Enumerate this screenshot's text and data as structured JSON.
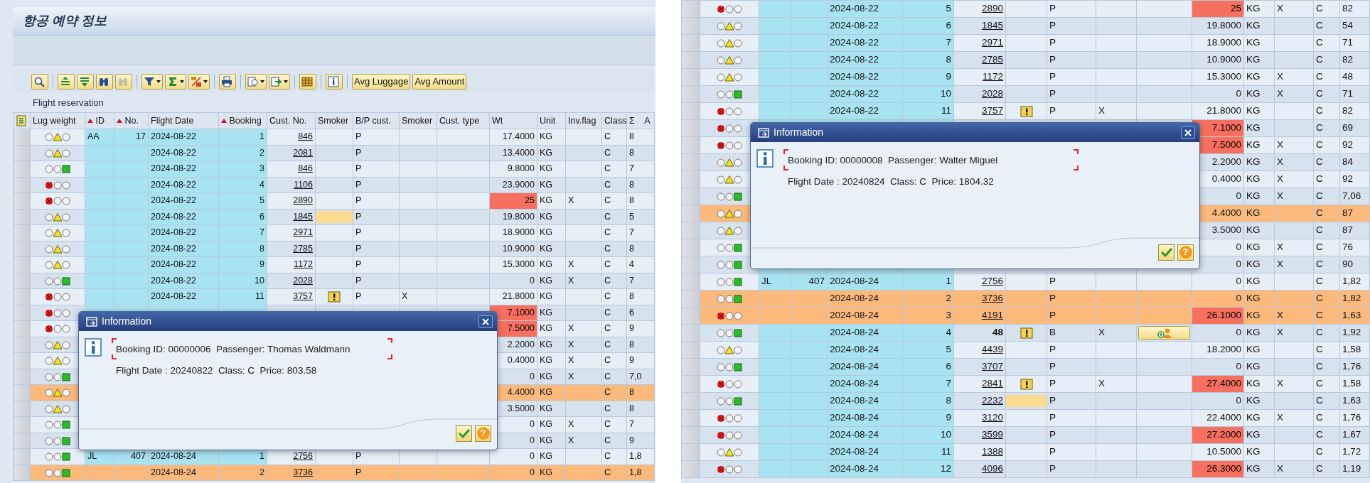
{
  "left_window": {
    "title": "항공 예약 정보",
    "toolbar": [
      {
        "kind": "icon",
        "dropdown": false,
        "disabled": false
      },
      {
        "kind": "icon",
        "dropdown": false,
        "disabled": false
      },
      {
        "kind": "icon",
        "dropdown": false,
        "disabled": false
      },
      {
        "kind": "icon",
        "dropdown": false,
        "disabled": false
      },
      {
        "kind": "icon",
        "dropdown": false,
        "disabled": true
      },
      {
        "kind": "icon",
        "dropdown": true,
        "disabled": false
      },
      {
        "kind": "icon",
        "dropdown": true,
        "disabled": false
      },
      {
        "kind": "icon",
        "dropdown": true,
        "disabled": false
      },
      {
        "kind": "icon",
        "dropdown": false,
        "disabled": false
      },
      {
        "kind": "icon",
        "dropdown": true,
        "disabled": false
      },
      {
        "kind": "icon",
        "dropdown": true,
        "disabled": false
      },
      {
        "kind": "icon",
        "dropdown": false,
        "disabled": false
      },
      {
        "kind": "icon",
        "dropdown": false,
        "disabled": false
      },
      {
        "kind": "text",
        "label": "Avg Luggage"
      },
      {
        "kind": "text",
        "label": "Avg Amount"
      }
    ],
    "grid_title": "Flight reservation",
    "columns": [
      {
        "label": "Lug weight",
        "sorted": false
      },
      {
        "label": "ID",
        "sorted": true
      },
      {
        "label": "No.",
        "sorted": true
      },
      {
        "label": "Flight Date",
        "sorted": false
      },
      {
        "label": "Booking",
        "sorted": true
      },
      {
        "label": "Cust. No.",
        "sorted": false
      },
      {
        "label": "Smoker",
        "sorted": false
      },
      {
        "label": "B/P cust.",
        "sorted": false
      },
      {
        "label": "Smoker",
        "sorted": false
      },
      {
        "label": "Cust. type",
        "sorted": false
      },
      {
        "label": "Wt",
        "sorted": false
      },
      {
        "label": "Unit",
        "sorted": false
      },
      {
        "label": "Inv.flag",
        "sorted": false
      },
      {
        "label": "Class",
        "sorted": false
      },
      {
        "label": "A",
        "sum_sign": "Σ",
        "sorted": false
      }
    ],
    "rows": [
      {
        "light": {
          "kind": "yellow"
        },
        "id": "AA",
        "no": "17",
        "date": "2024-08-22",
        "booking": "1",
        "cust": "846",
        "cust_link": true,
        "bp": "P",
        "wt": "17.4000",
        "wt_alert": false,
        "unit": "KG",
        "cls": "C",
        "amount": "8",
        "highlight": false
      },
      {
        "light": {
          "kind": "yellow"
        },
        "date": "2024-08-22",
        "booking": "2",
        "cust": "2081",
        "cust_link": true,
        "bp": "P",
        "wt": "13.4000",
        "wt_alert": false,
        "unit": "KG",
        "cls": "C",
        "amount": "8",
        "highlight": false
      },
      {
        "light": {
          "kind": "green"
        },
        "date": "2024-08-22",
        "booking": "3",
        "cust": "846",
        "cust_link": true,
        "bp": "P",
        "wt": "9.8000",
        "wt_alert": false,
        "unit": "KG",
        "cls": "C",
        "amount": "7",
        "highlight": false
      },
      {
        "light": {
          "kind": "red"
        },
        "date": "2024-08-22",
        "booking": "4",
        "cust": "1106",
        "cust_link": true,
        "bp": "P",
        "wt": "23.9000",
        "wt_alert": false,
        "unit": "KG",
        "cls": "C",
        "amount": "8",
        "highlight": false
      },
      {
        "light": {
          "kind": "red"
        },
        "date": "2024-08-22",
        "booking": "5",
        "cust": "2890",
        "cust_link": true,
        "bp": "P",
        "wt": "25",
        "wt_alert": true,
        "unit": "KG",
        "inv": "X",
        "cls": "C",
        "amount": "8",
        "highlight": false
      },
      {
        "light": {
          "kind": "yellow"
        },
        "date": "2024-08-22",
        "booking": "6",
        "cust": "1845",
        "cust_link": true,
        "smoker": {
          "kind": "input"
        },
        "bp": "P",
        "wt": "19.8000",
        "wt_alert": false,
        "unit": "KG",
        "cls": "C",
        "amount": "5",
        "highlight": false
      },
      {
        "light": {
          "kind": "yellow"
        },
        "date": "2024-08-22",
        "booking": "7",
        "cust": "2971",
        "cust_link": true,
        "bp": "P",
        "wt": "18.9000",
        "wt_alert": false,
        "unit": "KG",
        "cls": "C",
        "amount": "7",
        "highlight": false
      },
      {
        "light": {
          "kind": "yellow"
        },
        "date": "2024-08-22",
        "booking": "8",
        "cust": "2785",
        "cust_link": true,
        "bp": "P",
        "wt": "10.9000",
        "wt_alert": false,
        "unit": "KG",
        "cls": "C",
        "amount": "8",
        "highlight": false
      },
      {
        "light": {
          "kind": "yellow"
        },
        "date": "2024-08-22",
        "booking": "9",
        "cust": "1172",
        "cust_link": true,
        "bp": "P",
        "wt": "15.3000",
        "wt_alert": false,
        "unit": "KG",
        "inv": "X",
        "cls": "C",
        "amount": "4",
        "highlight": false
      },
      {
        "light": {
          "kind": "green"
        },
        "date": "2024-08-22",
        "booking": "10",
        "cust": "2028",
        "cust_link": true,
        "bp": "P",
        "wt": "0",
        "wt_alert": false,
        "unit": "KG",
        "inv": "X",
        "cls": "C",
        "amount": "7",
        "highlight": false
      },
      {
        "light": {
          "kind": "red"
        },
        "date": "2024-08-22",
        "booking": "11",
        "cust": "3757",
        "cust_link": true,
        "smoker": {
          "kind": "warning"
        },
        "bp": "P",
        "smoker2": "X",
        "wt": "21.8000",
        "wt_alert": false,
        "unit": "KG",
        "cls": "C",
        "amount": "8",
        "highlight": false
      },
      {
        "light": {
          "kind": "red"
        },
        "wt": "7.1000",
        "wt_alert": true,
        "unit": "KG",
        "cls": "C",
        "amount": "6",
        "highlight": false
      },
      {
        "light": {
          "kind": "red"
        },
        "wt": "7.5000",
        "wt_alert": true,
        "unit": "KG",
        "inv": "X",
        "cls": "C",
        "amount": "9",
        "highlight": false
      },
      {
        "light": {
          "kind": "yellow"
        },
        "wt": "2.2000",
        "wt_alert": false,
        "unit": "KG",
        "inv": "X",
        "cls": "C",
        "amount": "8",
        "highlight": false
      },
      {
        "light": {
          "kind": "yellow"
        },
        "wt": "0.4000",
        "wt_alert": false,
        "unit": "KG",
        "inv": "X",
        "cls": "C",
        "amount": "9",
        "highlight": false
      },
      {
        "light": {
          "kind": "green"
        },
        "wt": "0",
        "wt_alert": false,
        "unit": "KG",
        "inv": "X",
        "cls": "C",
        "amount": "7,0",
        "highlight": false
      },
      {
        "light": {
          "kind": "yellow"
        },
        "wt": "4.4000",
        "wt_alert": false,
        "unit": "KG",
        "cls": "C",
        "amount": "8",
        "highlight": true
      },
      {
        "light": {
          "kind": "yellow"
        },
        "wt": "3.5000",
        "wt_alert": false,
        "unit": "KG",
        "cls": "C",
        "amount": "8",
        "highlight": false
      },
      {
        "light": {
          "kind": "green"
        },
        "wt": "0",
        "wt_alert": false,
        "unit": "KG",
        "inv": "X",
        "cls": "C",
        "amount": "7",
        "highlight": false
      },
      {
        "light": {
          "kind": "green"
        },
        "wt": "0",
        "wt_alert": false,
        "unit": "KG",
        "inv": "X",
        "cls": "C",
        "amount": "9",
        "highlight": false
      },
      {
        "light": {
          "kind": "green"
        },
        "id": "JL",
        "no": "407",
        "date": "2024-08-24",
        "booking": "1",
        "cust": "2756",
        "cust_link": true,
        "bp": "P",
        "wt": "0",
        "wt_alert": false,
        "unit": "KG",
        "cls": "C",
        "amount": "1,8",
        "highlight": false
      },
      {
        "light": {
          "kind": "green"
        },
        "date": "2024-08-24",
        "booking": "2",
        "cust": "3736",
        "cust_link": true,
        "bp": "P",
        "wt": "0",
        "wt_alert": false,
        "unit": "KG",
        "cls": "C",
        "amount": "1,8",
        "highlight": true
      }
    ],
    "dialog": {
      "title": "Information",
      "lines": [
        "Booking ID: 00000006  Passenger: Thomas Waldmann",
        "Flight Date : 20240822  Class: C  Price: 803.58"
      ],
      "help_label": "?"
    }
  },
  "right_window": {
    "rows": [
      {
        "light": {
          "kind": "red"
        },
        "date": "2024-08-22",
        "booking": "5",
        "cust": "2890",
        "cust_link": true,
        "bp": "P",
        "wt": "25",
        "wt_alert": true,
        "unit": "KG",
        "inv": "X",
        "cls": "C",
        "amount": "82",
        "highlight": false
      },
      {
        "light": {
          "kind": "yellow"
        },
        "date": "2024-08-22",
        "booking": "6",
        "cust": "1845",
        "cust_link": true,
        "bp": "P",
        "wt": "19.8000",
        "wt_alert": false,
        "unit": "KG",
        "cls": "C",
        "amount": "54",
        "highlight": false
      },
      {
        "light": {
          "kind": "yellow"
        },
        "date": "2024-08-22",
        "booking": "7",
        "cust": "2971",
        "cust_link": true,
        "bp": "P",
        "wt": "18.9000",
        "wt_alert": false,
        "unit": "KG",
        "cls": "C",
        "amount": "71",
        "highlight": false
      },
      {
        "light": {
          "kind": "yellow"
        },
        "date": "2024-08-22",
        "booking": "8",
        "cust": "2785",
        "cust_link": true,
        "bp": "P",
        "wt": "10.9000",
        "wt_alert": false,
        "unit": "KG",
        "cls": "C",
        "amount": "82",
        "highlight": false
      },
      {
        "light": {
          "kind": "yellow"
        },
        "date": "2024-08-22",
        "booking": "9",
        "cust": "1172",
        "cust_link": true,
        "bp": "P",
        "wt": "15.3000",
        "wt_alert": false,
        "unit": "KG",
        "inv": "X",
        "cls": "C",
        "amount": "48",
        "highlight": false
      },
      {
        "light": {
          "kind": "green"
        },
        "date": "2024-08-22",
        "booking": "10",
        "cust": "2028",
        "cust_link": true,
        "bp": "P",
        "wt": "0",
        "wt_alert": false,
        "unit": "KG",
        "inv": "X",
        "cls": "C",
        "amount": "71",
        "highlight": false
      },
      {
        "light": {
          "kind": "red"
        },
        "date": "2024-08-22",
        "booking": "11",
        "cust": "3757",
        "cust_link": true,
        "smoker": {
          "kind": "warning"
        },
        "bp": "P",
        "smoker2": "X",
        "wt": "21.8000",
        "wt_alert": false,
        "unit": "KG",
        "cls": "C",
        "amount": "82",
        "highlight": false
      },
      {
        "light": {
          "kind": "red"
        },
        "wt": "7.1000",
        "wt_alert": true,
        "unit": "KG",
        "cls": "C",
        "amount": "69",
        "highlight": false
      },
      {
        "light": {
          "kind": "red"
        },
        "wt": "7.5000",
        "wt_alert": true,
        "unit": "KG",
        "inv": "X",
        "cls": "C",
        "amount": "92",
        "highlight": false
      },
      {
        "light": {
          "kind": "yellow"
        },
        "wt": "2.2000",
        "wt_alert": false,
        "unit": "KG",
        "inv": "X",
        "cls": "C",
        "amount": "84",
        "highlight": false
      },
      {
        "light": {
          "kind": "yellow"
        },
        "wt": "0.4000",
        "wt_alert": false,
        "unit": "KG",
        "inv": "X",
        "cls": "C",
        "amount": "92",
        "highlight": false
      },
      {
        "light": {
          "kind": "green"
        },
        "wt": "0",
        "wt_alert": false,
        "unit": "KG",
        "inv": "X",
        "cls": "C",
        "amount": "7,06",
        "highlight": false
      },
      {
        "light": {
          "kind": "yellow"
        },
        "wt": "4.4000",
        "wt_alert": false,
        "unit": "KG",
        "cls": "C",
        "amount": "87",
        "highlight": true
      },
      {
        "light": {
          "kind": "yellow"
        },
        "wt": "3.5000",
        "wt_alert": false,
        "unit": "KG",
        "cls": "C",
        "amount": "87",
        "highlight": false
      },
      {
        "light": {
          "kind": "green"
        },
        "wt": "0",
        "wt_alert": false,
        "unit": "KG",
        "inv": "X",
        "cls": "C",
        "amount": "76",
        "highlight": false
      },
      {
        "light": {
          "kind": "green"
        },
        "wt": "0",
        "wt_alert": false,
        "unit": "KG",
        "inv": "X",
        "cls": "C",
        "amount": "90",
        "highlight": false
      },
      {
        "light": {
          "kind": "green"
        },
        "id": "JL",
        "no": "407",
        "date": "2024-08-24",
        "booking": "1",
        "cust": "2756",
        "cust_link": true,
        "bp": "P",
        "wt": "0",
        "wt_alert": false,
        "unit": "KG",
        "cls": "C",
        "amount": "1,82",
        "highlight": false
      },
      {
        "light": {
          "kind": "green"
        },
        "date": "2024-08-24",
        "booking": "2",
        "cust": "3736",
        "cust_link": true,
        "bp": "P",
        "wt": "0",
        "wt_alert": false,
        "unit": "KG",
        "cls": "C",
        "amount": "1,82",
        "highlight": true
      },
      {
        "light": {
          "kind": "red"
        },
        "date": "2024-08-24",
        "booking": "3",
        "cust": "4191",
        "cust_link": true,
        "bp": "P",
        "wt": "26.1000",
        "wt_alert": true,
        "unit": "KG",
        "inv": "X",
        "cls": "C",
        "amount": "1,63",
        "highlight": true
      },
      {
        "light": {
          "kind": "green"
        },
        "date": "2024-08-24",
        "booking": "4",
        "cust": "48",
        "cust_link": false,
        "smoker": {
          "kind": "warning"
        },
        "bp": "B",
        "smoker2": "X",
        "cust_type": {
          "kind": "button"
        },
        "wt": "0",
        "wt_alert": false,
        "unit": "KG",
        "inv": "X",
        "cls": "C",
        "amount": "1,92",
        "highlight": false
      },
      {
        "light": {
          "kind": "yellow"
        },
        "date": "2024-08-24",
        "booking": "5",
        "cust": "4439",
        "cust_link": true,
        "bp": "P",
        "wt": "18.2000",
        "wt_alert": false,
        "unit": "KG",
        "cls": "C",
        "amount": "1,58",
        "highlight": false
      },
      {
        "light": {
          "kind": "green"
        },
        "date": "2024-08-24",
        "booking": "6",
        "cust": "3707",
        "cust_link": true,
        "bp": "P",
        "wt": "0",
        "wt_alert": false,
        "unit": "KG",
        "cls": "C",
        "amount": "1,76",
        "highlight": false
      },
      {
        "light": {
          "kind": "red"
        },
        "date": "2024-08-24",
        "booking": "7",
        "cust": "2841",
        "cust_link": true,
        "smoker": {
          "kind": "warning"
        },
        "bp": "P",
        "smoker2": "X",
        "wt": "27.4000",
        "wt_alert": true,
        "unit": "KG",
        "inv": "X",
        "cls": "C",
        "amount": "1,58",
        "highlight": false
      },
      {
        "light": {
          "kind": "green"
        },
        "date": "2024-08-24",
        "booking": "8",
        "cust": "2232",
        "cust_link": true,
        "smoker": {
          "kind": "input"
        },
        "bp": "P",
        "wt": "0",
        "wt_alert": false,
        "unit": "KG",
        "cls": "C",
        "amount": "1,63",
        "highlight": false
      },
      {
        "light": {
          "kind": "red"
        },
        "date": "2024-08-24",
        "booking": "9",
        "cust": "3120",
        "cust_link": true,
        "bp": "P",
        "wt": "22.4000",
        "wt_alert": false,
        "unit": "KG",
        "inv": "X",
        "cls": "C",
        "amount": "1,76",
        "highlight": false
      },
      {
        "light": {
          "kind": "red"
        },
        "date": "2024-08-24",
        "booking": "10",
        "cust": "3599",
        "cust_link": true,
        "bp": "P",
        "wt": "27.2000",
        "wt_alert": true,
        "unit": "KG",
        "cls": "C",
        "amount": "1,67",
        "highlight": false
      },
      {
        "light": {
          "kind": "yellow"
        },
        "date": "2024-08-24",
        "booking": "11",
        "cust": "1388",
        "cust_link": true,
        "bp": "P",
        "wt": "10.5000",
        "wt_alert": false,
        "unit": "KG",
        "cls": "C",
        "amount": "1,72",
        "highlight": false
      },
      {
        "light": {
          "kind": "red"
        },
        "date": "2024-08-24",
        "booking": "12",
        "cust": "4096",
        "cust_link": true,
        "bp": "P",
        "wt": "26.3000",
        "wt_alert": true,
        "unit": "KG",
        "inv": "X",
        "cls": "C",
        "amount": "1,19",
        "highlight": false
      }
    ],
    "dialog": {
      "title": "Information",
      "lines": [
        "Booking ID: 00000008  Passenger: Walter Miguel",
        "Flight Date : 20240824  Class: C  Price: 1804.32"
      ],
      "help_label": "?"
    }
  }
}
